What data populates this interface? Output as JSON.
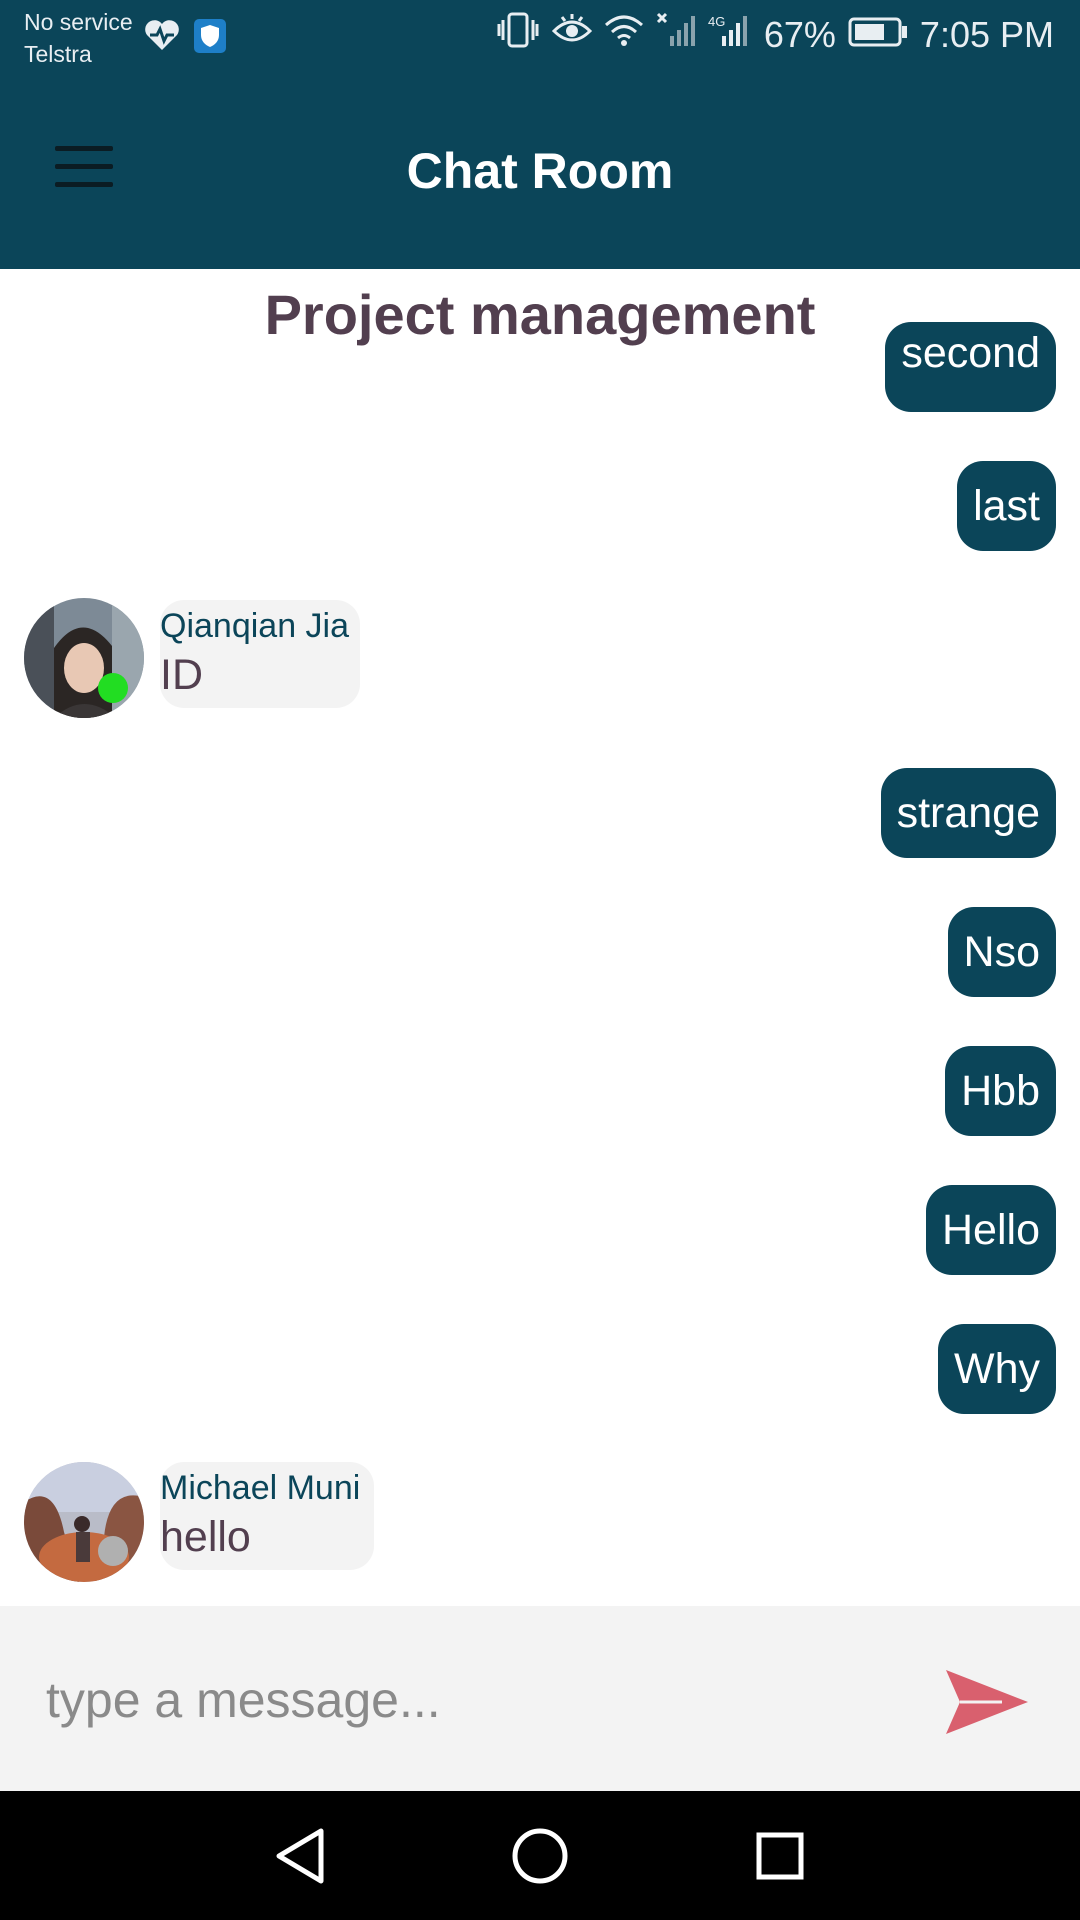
{
  "status_bar": {
    "carrier_line1": "No service",
    "carrier_line2": "Telstra",
    "battery": "67%",
    "time": "7:05 PM",
    "icons": [
      "heart-rate-icon",
      "shield-icon",
      "vibrate-icon",
      "eye-icon",
      "wifi-icon",
      "signal-icon",
      "signal-4g-icon",
      "battery-icon"
    ]
  },
  "app_bar": {
    "title": "Chat Room",
    "menu_icon": "hamburger-menu-icon"
  },
  "room": {
    "title": "Project management"
  },
  "messages": [
    {
      "type": "outgoing",
      "text": "second"
    },
    {
      "type": "outgoing",
      "text": "last"
    },
    {
      "type": "incoming",
      "sender": "Qianqian Jia",
      "text": "ID",
      "online": true
    },
    {
      "type": "outgoing",
      "text": "strange"
    },
    {
      "type": "outgoing",
      "text": "Nso"
    },
    {
      "type": "outgoing",
      "text": "Hbb"
    },
    {
      "type": "outgoing",
      "text": "Hello"
    },
    {
      "type": "outgoing",
      "text": "Why"
    },
    {
      "type": "incoming",
      "sender": "Michael Muni",
      "text": "hello",
      "online": false
    }
  ],
  "composer": {
    "placeholder": "type a message...",
    "value": "",
    "send_icon": "send-icon"
  },
  "nav_bar": {
    "icons": [
      "back-icon",
      "home-icon",
      "recents-icon"
    ]
  },
  "colors": {
    "primary": "#0b4559",
    "title_text": "#523f4f",
    "send_accent": "#d9606e",
    "online": "#22dd22",
    "offline": "#b0b0b0"
  }
}
